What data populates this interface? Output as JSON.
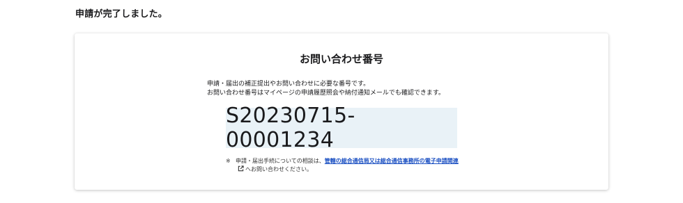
{
  "completion_message": "申請が完了しました。",
  "card": {
    "title": "お問い合わせ番号",
    "description_line1": "申請・届出の補正提出やお問い合わせに必要な番号です。",
    "description_line2": "お問い合わせ番号はマイページの申請履歴照会や納付通知メールでも確認できます。",
    "inquiry_number": "S20230715-00001234"
  },
  "note": {
    "mark": "※",
    "text_before": "申請・届出手続についての相談は、",
    "link_text": "管轄の総合通信局又は総合通信事務所の電子申請関連",
    "link_icon": "external-link-icon",
    "text_after": "へお問い合わせください。"
  },
  "colors": {
    "link": "#1a4fc2",
    "number_box_bg": "#e9f2f7"
  }
}
